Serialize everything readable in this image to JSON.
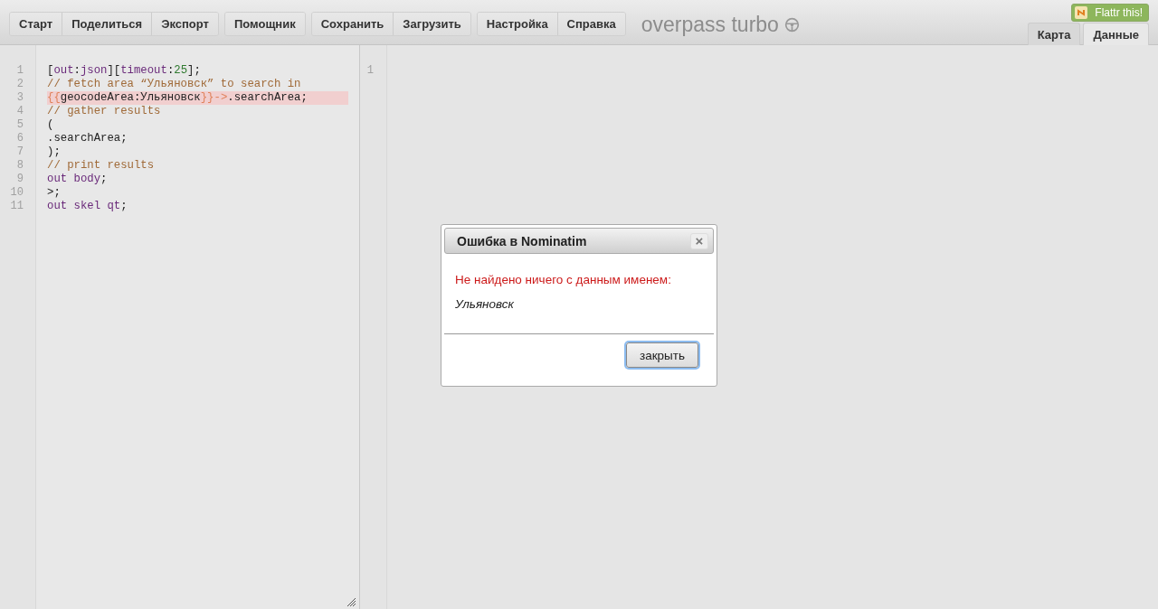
{
  "toolbar": {
    "groups": [
      [
        "Старт",
        "Поделиться",
        "Экспорт"
      ],
      [
        "Помощник"
      ],
      [
        "Сохранить",
        "Загрузить"
      ],
      [
        "Настройка",
        "Справка"
      ]
    ]
  },
  "logo": {
    "title": "overpass turbo"
  },
  "flattr": {
    "label": "Flattr this!"
  },
  "view_tabs": [
    {
      "label": "Карта",
      "selected": false
    },
    {
      "label": "Данные",
      "selected": true
    }
  ],
  "editor": {
    "lines": [
      {
        "number": "1",
        "highlighted": false,
        "tokens": [
          {
            "kind": "plain",
            "text": "["
          },
          {
            "kind": "keyword",
            "text": "out"
          },
          {
            "kind": "plain",
            "text": ":"
          },
          {
            "kind": "keyword",
            "text": "json"
          },
          {
            "kind": "plain",
            "text": "]["
          },
          {
            "kind": "keyword",
            "text": "timeout"
          },
          {
            "kind": "plain",
            "text": ":"
          },
          {
            "kind": "number",
            "text": "25"
          },
          {
            "kind": "plain",
            "text": "];"
          }
        ]
      },
      {
        "number": "2",
        "highlighted": false,
        "tokens": [
          {
            "kind": "comment",
            "text": "// fetch area “Ульяновск” to search in"
          }
        ]
      },
      {
        "number": "3",
        "highlighted": true,
        "tokens": [
          {
            "kind": "template",
            "text": "{{"
          },
          {
            "kind": "plain",
            "text": "geocodeArea:Ульяновск"
          },
          {
            "kind": "template",
            "text": "}}"
          },
          {
            "kind": "template",
            "text": "->"
          },
          {
            "kind": "plain",
            "text": ".searchArea;"
          }
        ]
      },
      {
        "number": "4",
        "highlighted": false,
        "tokens": [
          {
            "kind": "comment",
            "text": "// gather results"
          }
        ]
      },
      {
        "number": "5",
        "highlighted": false,
        "tokens": [
          {
            "kind": "plain",
            "text": "("
          }
        ]
      },
      {
        "number": "6",
        "highlighted": false,
        "tokens": [
          {
            "kind": "plain",
            "text": ".searchArea;"
          }
        ]
      },
      {
        "number": "7",
        "highlighted": false,
        "tokens": [
          {
            "kind": "plain",
            "text": ");"
          }
        ]
      },
      {
        "number": "8",
        "highlighted": false,
        "tokens": [
          {
            "kind": "comment",
            "text": "// print results"
          }
        ]
      },
      {
        "number": "9",
        "highlighted": false,
        "tokens": [
          {
            "kind": "keyword",
            "text": "out body"
          },
          {
            "kind": "plain",
            "text": ";"
          }
        ]
      },
      {
        "number": "10",
        "highlighted": false,
        "tokens": [
          {
            "kind": "plain",
            "text": ">;"
          }
        ]
      },
      {
        "number": "11",
        "highlighted": false,
        "tokens": [
          {
            "kind": "keyword",
            "text": "out skel qt"
          },
          {
            "kind": "plain",
            "text": ";"
          }
        ]
      }
    ]
  },
  "data_view": {
    "line_numbers": [
      "1"
    ]
  },
  "dialog": {
    "title": "Ошибка в Nominatim",
    "close_icon": "×",
    "message": "Не найдено ничего с данным именем:",
    "query": "Ульяновск",
    "button": "закрыть"
  }
}
